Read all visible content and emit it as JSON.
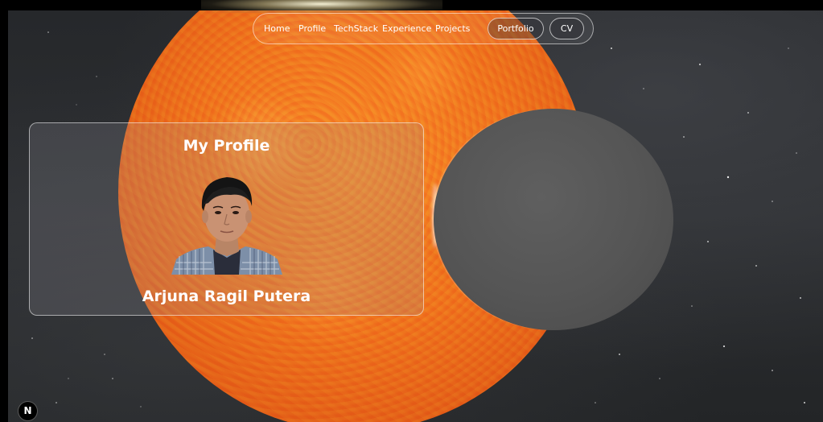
{
  "nav": {
    "links": {
      "home": "Home",
      "profile": "Profile",
      "techstack": "TechStack",
      "experience": "Experience",
      "projects": "Projects"
    },
    "buttons": {
      "portfolio": "Portfolio",
      "cv": "CV"
    }
  },
  "profile_card": {
    "title": "My Profile",
    "name": "Arjuna Ragil Putera"
  },
  "badge": {
    "letter": "N"
  },
  "colors": {
    "sun": "#ee7420",
    "planet": "#555555",
    "space": "#2a2c2f",
    "text": "#ffffff"
  }
}
